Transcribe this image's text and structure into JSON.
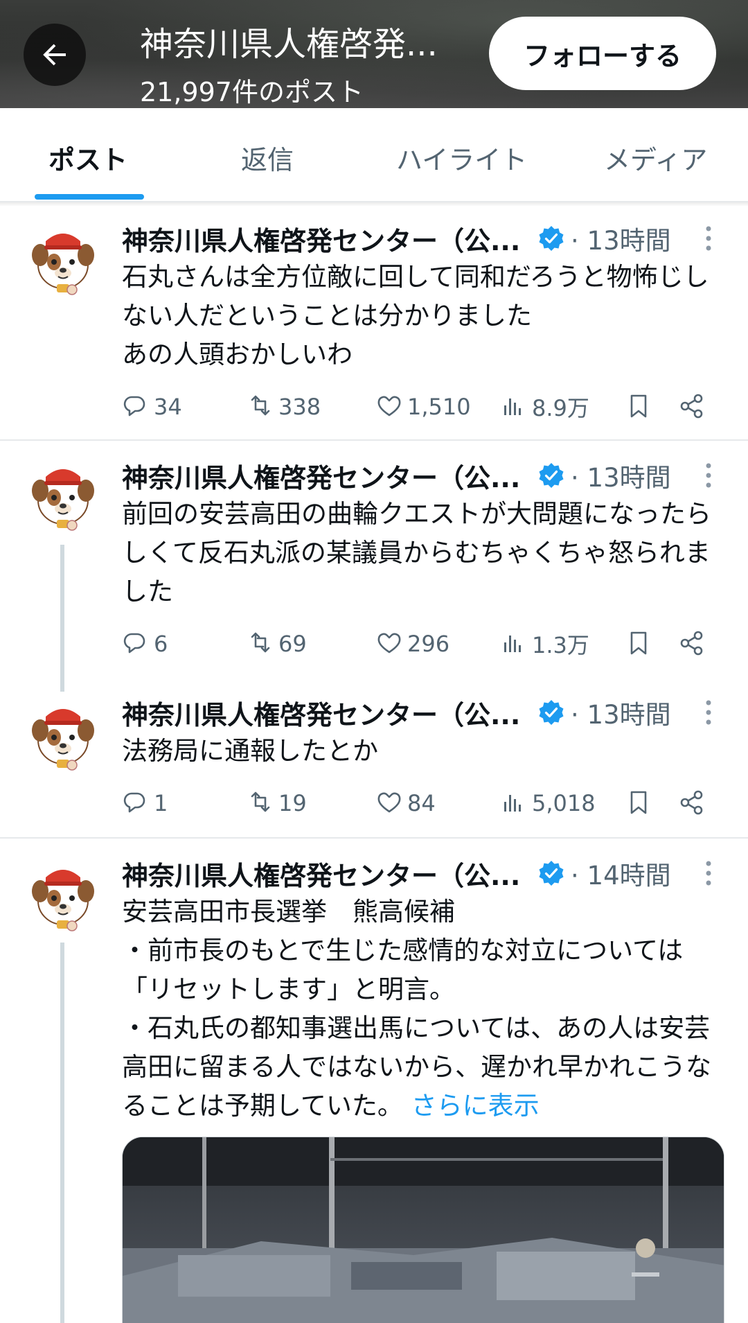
{
  "header": {
    "title": "神奈川県人権啓発...",
    "post_count": "21,997件のポスト",
    "follow_label": "フォローする"
  },
  "tabs": [
    {
      "label": "ポスト",
      "active": true
    },
    {
      "label": "返信",
      "active": false
    },
    {
      "label": "ハイライト",
      "active": false
    },
    {
      "label": "メディア",
      "active": false
    }
  ],
  "posts": [
    {
      "name": "神奈川県人権啓発センター（公...",
      "time": "· 13時間",
      "text": "石丸さんは全方位敵に回して同和だろうと物怖じしない人だということは分かりました\nあの人頭おかしいわ",
      "replies": "34",
      "reposts": "338",
      "likes": "1,510",
      "views": "8.9万"
    },
    {
      "name": "神奈川県人権啓発センター（公...",
      "time": "· 13時間",
      "text": "前回の安芸高田の曲輪クエストが大問題になったらしくて反石丸派の某議員からむちゃくちゃ怒られました",
      "replies": "6",
      "reposts": "69",
      "likes": "296",
      "views": "1.3万"
    },
    {
      "name": "神奈川県人権啓発センター（公...",
      "time": "· 13時間",
      "text": "法務局に通報したとか",
      "replies": "1",
      "reposts": "19",
      "likes": "84",
      "views": "5,018"
    },
    {
      "name": "神奈川県人権啓発センター（公...",
      "time": "· 14時間",
      "text": "安芸高田市長選挙　熊高候補\n・前市長のもとで生じた感情的な対立については「リセットします」と明言。\n・石丸氏の都知事選出馬については、あの人は安芸高田に留まる人ではないから、遅かれ早かれこうなることは予期していた。",
      "show_more": "さらに表示"
    }
  ],
  "colors": {
    "accent": "#1d9bf0",
    "secondary_text": "#536471",
    "thread_line": "#cfd9de"
  }
}
